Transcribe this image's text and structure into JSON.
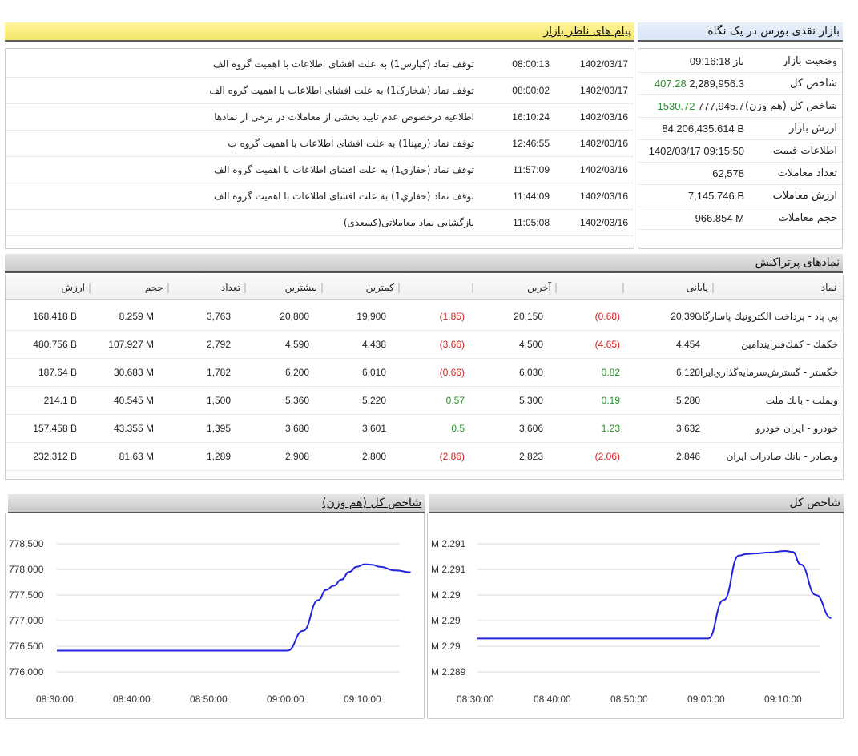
{
  "messages_panel": {
    "title": "پیام های ناظر بازار",
    "items": [
      {
        "date": "1402/03/17",
        "time": "08:00:13",
        "text": "توقف نماد (کپارس1) به علت افشای اطلاعات با اهمیت گروه الف"
      },
      {
        "date": "1402/03/17",
        "time": "08:00:02",
        "text": "توقف نماد (شخارک1) به علت افشای اطلاعات با اهمیت گروه الف"
      },
      {
        "date": "1402/03/16",
        "time": "16:10:24",
        "text": "اطلاعیه درخصوص عدم تایید بخشی از معاملات در برخی از نمادها"
      },
      {
        "date": "1402/03/16",
        "time": "12:46:55",
        "text": "توقف نماد (رمپنا1) به علت افشای اطلاعات با اهمیت گروه ب"
      },
      {
        "date": "1402/03/16",
        "time": "11:57:09",
        "text": "توقف نماد (حفاري1) به علت افشای اطلاعات با اهمیت گروه الف"
      },
      {
        "date": "1402/03/16",
        "time": "11:44:09",
        "text": "توقف نماد (حفاري1) به علت افشای اطلاعات با اهمیت گروه الف"
      },
      {
        "date": "1402/03/16",
        "time": "11:05:08",
        "text": "بازگشایی نماد معاملاتی(کسعدی)"
      }
    ]
  },
  "market_glance": {
    "title": "بازار نقدی بورس در یک نگاه",
    "rows": [
      {
        "label": "وضعیت بازار",
        "value": "باز 09:16:18",
        "change": ""
      },
      {
        "label": "شاخص کل",
        "value": "2,289,956.3",
        "change": "407.28"
      },
      {
        "label": "شاخص کل (هم وزن)",
        "value": "777,945.7",
        "change": "1530.72"
      },
      {
        "label": "ارزش بازار",
        "value": "84,206,435.614 B",
        "change": ""
      },
      {
        "label": "اطلاعات قیمت",
        "value": "1402/03/17 09:15:50",
        "change": ""
      },
      {
        "label": "تعداد معاملات",
        "value": "62,578",
        "change": ""
      },
      {
        "label": "ارزش معاملات",
        "value": "7,145.746 B",
        "change": ""
      },
      {
        "label": "حجم معاملات",
        "value": "966.854 M",
        "change": ""
      }
    ]
  },
  "top_symbols": {
    "title": "نمادهای پرتراکنش",
    "headers": {
      "symbol": "نماد",
      "close": "پایانی",
      "last": "آخرین",
      "low": "کمترین",
      "high": "بیشترین",
      "count": "تعداد",
      "volume": "حجم",
      "value": "ارزش"
    },
    "rows": [
      {
        "name": "پي پاد - پرداخت الكترونيك پاسارگاد",
        "close": "20,390",
        "close_chg": "(0.68)",
        "last": "20,150",
        "last_chg": "(1.85)",
        "low": "19,900",
        "high": "20,800",
        "count": "3,763",
        "volume": "8.259 M",
        "value": "168.418 B"
      },
      {
        "name": "خكمك - كمك‌فنرايندامين",
        "close": "4,454",
        "close_chg": "(4.65)",
        "last": "4,500",
        "last_chg": "(3.66)",
        "low": "4,438",
        "high": "4,590",
        "count": "2,792",
        "volume": "107.927 M",
        "value": "480.756 B"
      },
      {
        "name": "خگستر - گسترش‌سرمايه‌گذاري‌ايرا...",
        "close": "6,120",
        "close_chg": "0.82",
        "last": "6,030",
        "last_chg": "(0.66)",
        "low": "6,010",
        "high": "6,200",
        "count": "1,782",
        "volume": "30.683 M",
        "value": "187.64 B"
      },
      {
        "name": "وبملت - بانك ملت",
        "close": "5,280",
        "close_chg": "0.19",
        "last": "5,300",
        "last_chg": "0.57",
        "low": "5,220",
        "high": "5,360",
        "count": "1,500",
        "volume": "40.545 M",
        "value": "214.1 B"
      },
      {
        "name": "خودرو - ايران خودرو",
        "close": "3,632",
        "close_chg": "1.23",
        "last": "3,606",
        "last_chg": "0.5",
        "low": "3,601",
        "high": "3,680",
        "count": "1,395",
        "volume": "43.355 M",
        "value": "157.458 B"
      },
      {
        "name": "وبصادر - بانك صادرات ايران",
        "close": "2,846",
        "close_chg": "(2.06)",
        "last": "2,823",
        "last_chg": "(2.86)",
        "low": "2,800",
        "high": "2,908",
        "count": "1,289",
        "volume": "81.63 M",
        "value": "232.312 B"
      }
    ]
  },
  "colors": {
    "negative": "#d21f1f",
    "positive": "#2a8f2a",
    "line": "#2424e0",
    "grid": "#d9d9d9"
  },
  "chart_data": [
    {
      "type": "line",
      "title": "شاخص کل (هم وزن)",
      "x_ticks": [
        "08:30:00",
        "08:40:00",
        "08:50:00",
        "09:00:00",
        "09:10:00"
      ],
      "y_ticks": [
        "776,000",
        "776,500",
        "777,000",
        "777,500",
        "778,000",
        "778,500"
      ],
      "ylim": [
        776000,
        778500
      ],
      "xlim_minutes": [
        0,
        46
      ],
      "grid": "horizontal",
      "series": [
        {
          "x": [
            0,
            10,
            20,
            30,
            32,
            34,
            35,
            36,
            37,
            38,
            39,
            40,
            41,
            42,
            44,
            46
          ],
          "y": [
            776415,
            776415,
            776415,
            776415,
            776800,
            777400,
            777600,
            777680,
            777800,
            777950,
            778050,
            778100,
            778090,
            778050,
            777980,
            777945
          ]
        }
      ]
    },
    {
      "type": "line",
      "title": "شاخص کل",
      "x_ticks": [
        "08:30:00",
        "08:40:00",
        "08:50:00",
        "09:00:00",
        "09:10:00"
      ],
      "y_ticks": [
        "M 2.289",
        "M 2.29",
        "M 2.29",
        "M 2.29",
        "M 2.291",
        "M 2.291"
      ],
      "ylim": [
        2288900,
        2291400
      ],
      "xlim_minutes": [
        0,
        46
      ],
      "grid": "horizontal",
      "series": [
        {
          "x": [
            0,
            10,
            20,
            30,
            32,
            34,
            35,
            36,
            38,
            40,
            41,
            42,
            44,
            46
          ],
          "y": [
            2289550,
            2289550,
            2289550,
            2289550,
            2290300,
            2291170,
            2291200,
            2291210,
            2291230,
            2291260,
            2291240,
            2291000,
            2290400,
            2289950
          ]
        }
      ]
    }
  ]
}
